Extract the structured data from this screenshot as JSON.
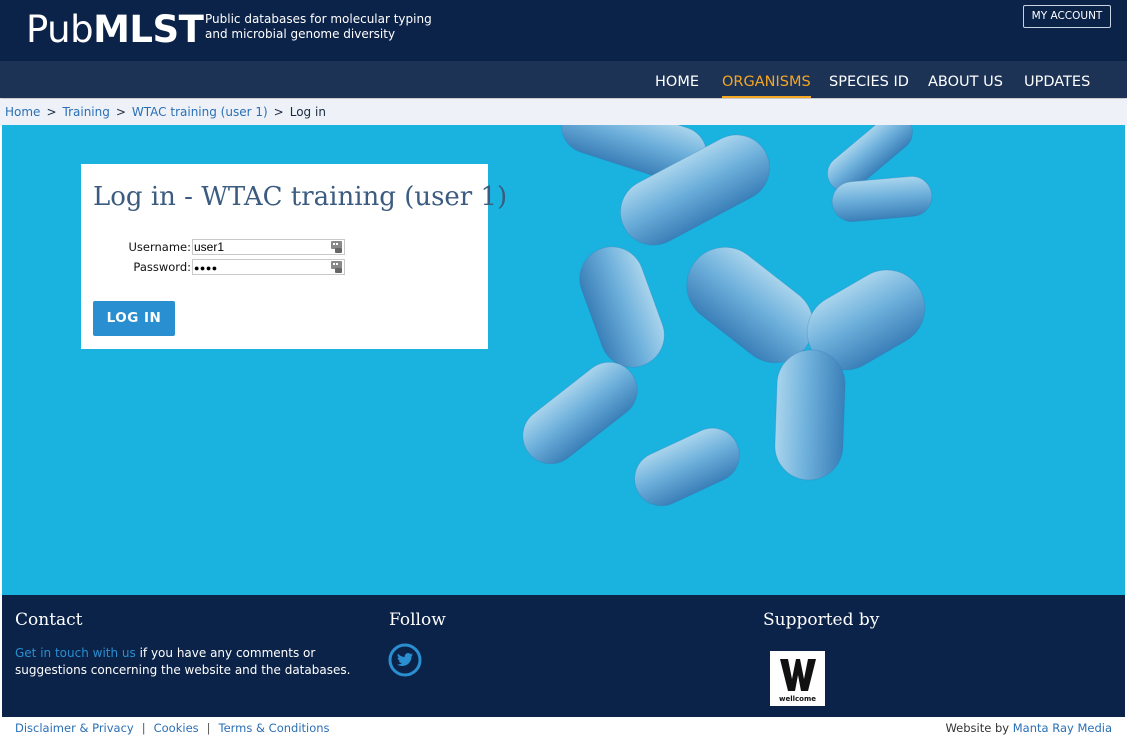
{
  "header": {
    "logo_prefix": "Pub",
    "logo_bold": "MLST",
    "tagline_line1": "Public databases for molecular typing",
    "tagline_line2": "and microbial genome diversity",
    "account_button": "MY ACCOUNT"
  },
  "nav": {
    "items": [
      {
        "label": "HOME"
      },
      {
        "label": "ORGANISMS",
        "active": true
      },
      {
        "label": "SPECIES ID"
      },
      {
        "label": "ABOUT US"
      },
      {
        "label": "UPDATES"
      }
    ]
  },
  "breadcrumb": {
    "items": [
      "Home",
      "Training",
      "WTAC training (user 1)"
    ],
    "current": "Log in",
    "separator": ">"
  },
  "login": {
    "title": "Log in - WTAC training (user 1)",
    "username_label": "Username:",
    "username_value": "user1",
    "password_label": "Password:",
    "password_value": "●●●●",
    "button_label": "LOG IN"
  },
  "footer": {
    "contact_heading": "Contact",
    "contact_link": "Get in touch with us",
    "contact_text": " if you have any comments or suggestions concerning the website and the databases.",
    "follow_heading": "Follow",
    "supported_heading": "Supported by",
    "wellcome_text": "wellcome"
  },
  "bottom": {
    "disclaimer": "Disclaimer & Privacy",
    "cookies": "Cookies",
    "terms": "Terms & Conditions",
    "credit_prefix": "Website by ",
    "credit_link": "Manta Ray Media",
    "pipe": "|"
  },
  "colors": {
    "header_bg": "#0b2249",
    "nav_bg": "#1c3356",
    "accent": "#f5a623",
    "hero_bg": "#1ab3e0",
    "button": "#2a8fd0"
  }
}
